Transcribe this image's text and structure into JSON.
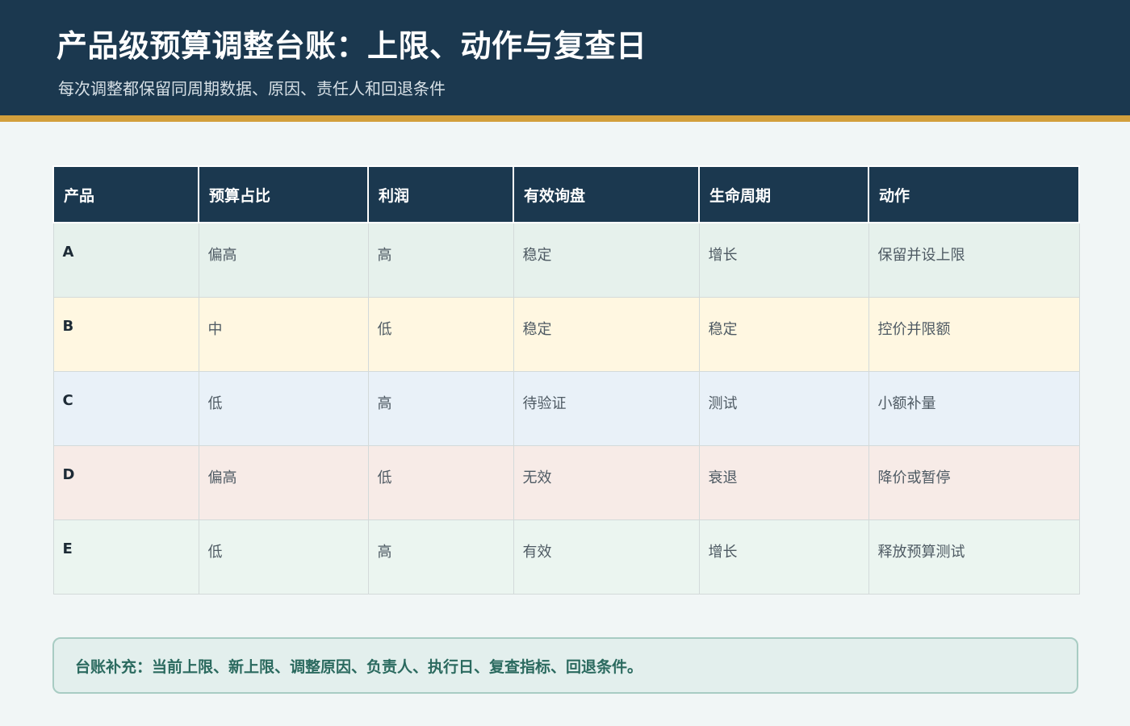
{
  "header": {
    "title": "产品级预算调整台账：上限、动作与复查日",
    "subtitle": "每次调整都保留同周期数据、原因、责任人和回退条件",
    "background_color": "#1b384f",
    "accent_color": "#d39f3c"
  },
  "table": {
    "columns": [
      "产品",
      "预算占比",
      "利润",
      "有效询盘",
      "生命周期",
      "动作"
    ],
    "rows": [
      {
        "cells": [
          "A",
          "偏高",
          "高",
          "稳定",
          "增长",
          "保留并设上限"
        ],
        "bg": "#e6f1ec"
      },
      {
        "cells": [
          "B",
          "中",
          "低",
          "稳定",
          "稳定",
          "控价并限额"
        ],
        "bg": "#fff7e1"
      },
      {
        "cells": [
          "C",
          "低",
          "高",
          "待验证",
          "测试",
          "小额补量"
        ],
        "bg": "#e9f1f8"
      },
      {
        "cells": [
          "D",
          "偏高",
          "低",
          "无效",
          "衰退",
          "降价或暂停"
        ],
        "bg": "#f7ebe7"
      },
      {
        "cells": [
          "E",
          "低",
          "高",
          "有效",
          "增长",
          "释放预算测试"
        ],
        "bg": "#ebf5f0"
      }
    ]
  },
  "note": {
    "text": "台账补充：当前上限、新上限、调整原因、负责人、执行日、复查指标、回退条件。"
  }
}
